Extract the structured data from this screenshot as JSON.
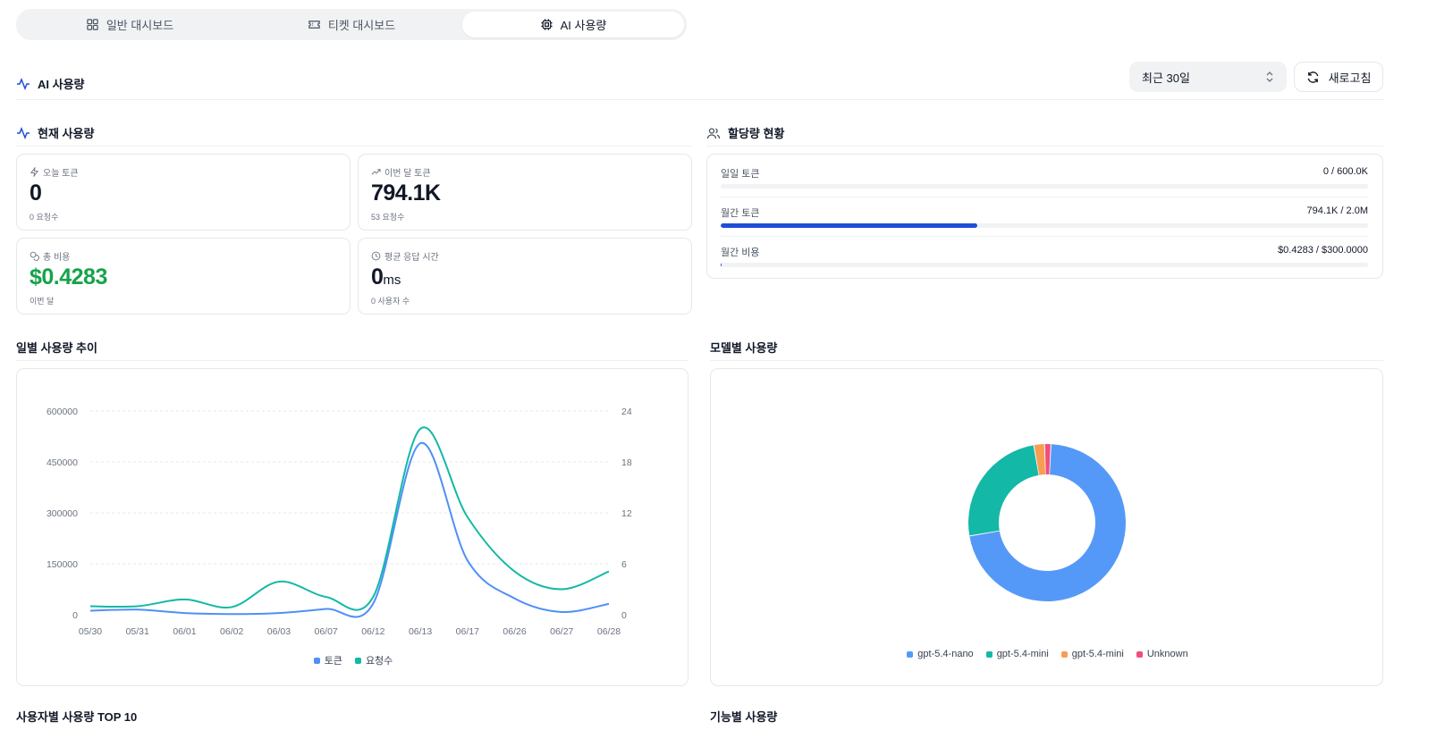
{
  "tabs": [
    {
      "label": "일반 대시보드",
      "icon": "grid-icon",
      "active": false
    },
    {
      "label": "티켓 대시보드",
      "icon": "ticket-icon",
      "active": false
    },
    {
      "label": "AI 사용량",
      "icon": "chip-icon",
      "active": true
    }
  ],
  "header": {
    "title": "AI 사용량",
    "period_value": "최근 30일",
    "refresh_label": "새로고침"
  },
  "current_usage": {
    "title": "현재 사용량",
    "stats": [
      {
        "label": "오늘 토큰",
        "value": "0",
        "sub": "0 요청수"
      },
      {
        "label": "이번 달 토큰",
        "value": "794.1K",
        "sub": "53 요청수"
      },
      {
        "label": "총 비용",
        "value": "$0.4283",
        "sub": "이번 달"
      },
      {
        "label": "평균 응답 시간",
        "value": "0",
        "unit": "ms",
        "sub": "0 사용자 수"
      }
    ]
  },
  "quota": {
    "title": "할당량 현황",
    "rows": [
      {
        "label": "일일 토큰",
        "value": "0 / 600.0K",
        "fraction": 0
      },
      {
        "label": "월간 토큰",
        "value": "794.1K / 2.0M",
        "fraction": 0.397
      },
      {
        "label": "월간 비용",
        "value": "$0.4283 / $300.0000",
        "fraction": 0.0014
      }
    ]
  },
  "daily_trend": {
    "title": "일별 사용량 추이"
  },
  "model_usage": {
    "title": "모델별 사용량"
  },
  "top_users": {
    "title": "사용자별 사용량 TOP 10"
  },
  "feature_usage": {
    "title": "기능별 사용량"
  },
  "colors": {
    "accent": "#1d4ed8",
    "tokens": "#4f8ff7",
    "requests": "#14b8a6",
    "green": "#16a34a"
  },
  "chart_data": [
    {
      "type": "line",
      "categories": [
        "05/30",
        "05/31",
        "06/01",
        "06/02",
        "06/03",
        "06/07",
        "06/12",
        "06/13",
        "06/17",
        "06/26",
        "06/27",
        "06/28"
      ],
      "series": [
        {
          "name": "토큰",
          "axis": "left",
          "color": "#4f8ff7",
          "values": [
            12000,
            15000,
            5000,
            2000,
            5000,
            17000,
            33000,
            505000,
            160000,
            48000,
            8000,
            32000
          ]
        },
        {
          "name": "요청수",
          "axis": "right",
          "color": "#14b8a6",
          "values": [
            1,
            1,
            1.8,
            0.9,
            3.9,
            2.1,
            2.1,
            21.9,
            11.5,
            5.1,
            3,
            5.1
          ]
        }
      ],
      "y_left": {
        "ticks": [
          "0",
          "150000",
          "300000",
          "450000",
          "600000"
        ],
        "range": [
          0,
          600000
        ]
      },
      "y_right": {
        "ticks": [
          "0",
          "6",
          "12",
          "18",
          "24"
        ],
        "range": [
          0,
          24
        ]
      },
      "grid": true,
      "legend": "bottom"
    },
    {
      "type": "pie",
      "variant": "donut",
      "labels": [
        "gpt-5.4-nano",
        "gpt-5.4-mini",
        "gpt-5.4-mini",
        "Unknown"
      ],
      "values": [
        71.5,
        25,
        2.2,
        1.3
      ],
      "colors": [
        "#5599f8",
        "#14b8a6",
        "#f59e54",
        "#ef4f7b"
      ],
      "legend": "bottom"
    }
  ]
}
